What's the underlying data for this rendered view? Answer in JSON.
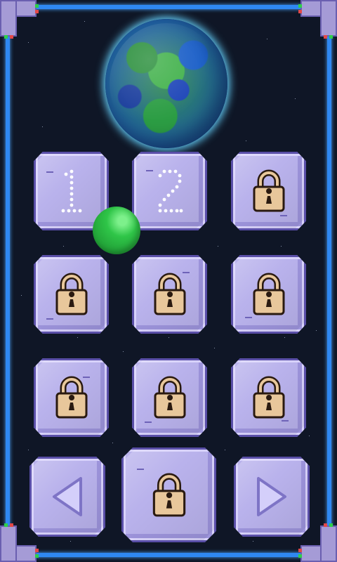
{
  "planet": {
    "name": "planet-icon"
  },
  "levels": [
    {
      "label": "1",
      "locked": false
    },
    {
      "label": "2",
      "locked": false
    },
    {
      "label": "",
      "locked": true
    },
    {
      "label": "",
      "locked": true
    },
    {
      "label": "",
      "locked": true
    },
    {
      "label": "",
      "locked": true
    },
    {
      "label": "",
      "locked": true
    },
    {
      "label": "",
      "locked": true
    },
    {
      "label": "",
      "locked": true
    }
  ],
  "nav": {
    "prev_icon": "triangle-left-icon",
    "center_icon": "padlock-icon",
    "next_icon": "triangle-right-icon"
  },
  "colors": {
    "background": "#0f1626",
    "frame": "#2f88f2",
    "tile": "#b9b2ec",
    "tile_border": "#5a4fa8",
    "lock_body": "#e8c79b",
    "ball": "#2fc548"
  }
}
